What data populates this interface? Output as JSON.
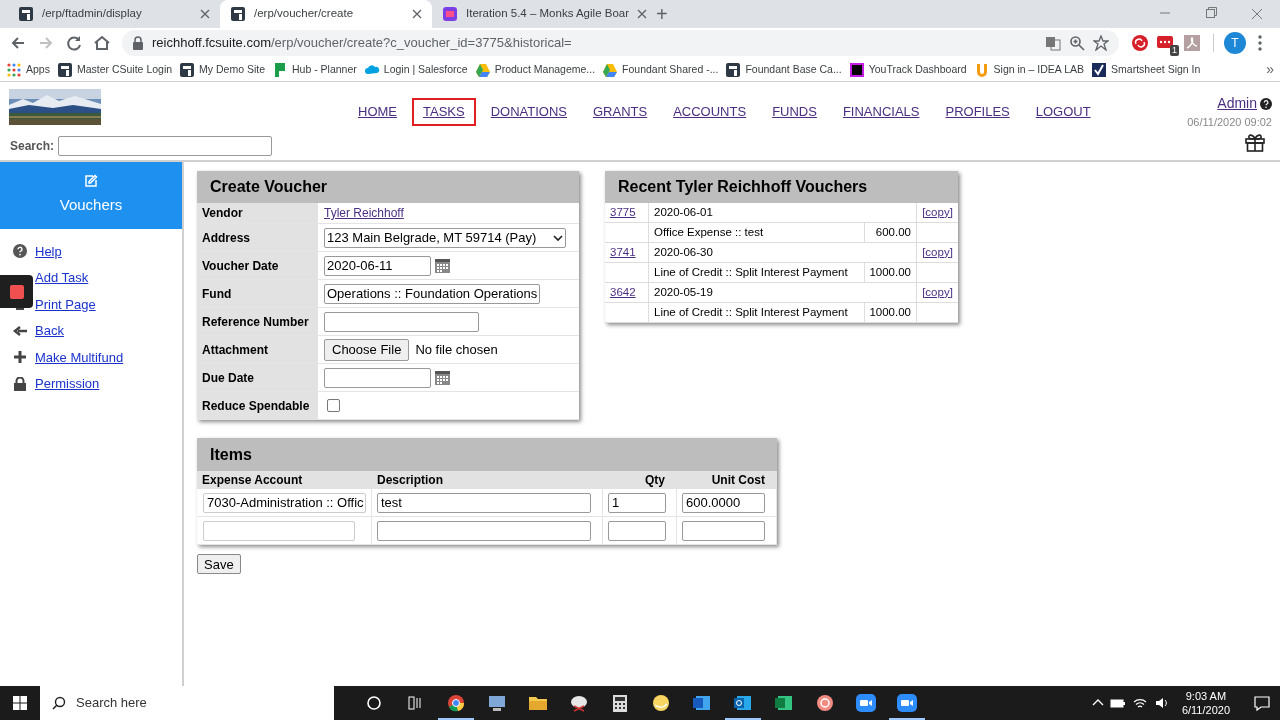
{
  "browser": {
    "tabs": [
      {
        "title": "/erp/ftadmin/display",
        "selected": false,
        "kind": "site"
      },
      {
        "title": "/erp/voucher/create",
        "selected": true,
        "kind": "site"
      },
      {
        "title": "Iteration 5.4 – Monks Agile Boar",
        "selected": false,
        "kind": "board"
      }
    ],
    "new_tab": "+",
    "url_host": "reichhoff.fcsuite.com",
    "url_path": "/erp/voucher/create?c_voucher_id=3775&historical=",
    "profile_initial": "T",
    "extension_badge": "1",
    "bookmarks": [
      {
        "label": "Apps",
        "kind": "apps"
      },
      {
        "label": "Master CSuite Login",
        "kind": "site"
      },
      {
        "label": "My Demo Site",
        "kind": "site"
      },
      {
        "label": "Hub - Planner",
        "kind": "planner"
      },
      {
        "label": "Login | Salesforce",
        "kind": "cloud"
      },
      {
        "label": "Product Manageme...",
        "kind": "drive"
      },
      {
        "label": "Foundant Shared -...",
        "kind": "drive"
      },
      {
        "label": "Foundant Base Ca...",
        "kind": "site"
      },
      {
        "label": "YouTrack Dashboard",
        "kind": "track"
      },
      {
        "label": "Sign in – IDEA LAB",
        "kind": "lab"
      },
      {
        "label": "Smartsheet Sign In",
        "kind": "sheet"
      }
    ],
    "more_bookmarks": "»"
  },
  "header": {
    "nav": [
      {
        "label": "HOME",
        "selected": false
      },
      {
        "label": "TASKS",
        "selected": true
      },
      {
        "label": "DONATIONS",
        "selected": false
      },
      {
        "label": "GRANTS",
        "selected": false
      },
      {
        "label": "ACCOUNTS",
        "selected": false
      },
      {
        "label": "FUNDS",
        "selected": false
      },
      {
        "label": "FINANCIALS",
        "selected": false
      },
      {
        "label": "PROFILES",
        "selected": false
      },
      {
        "label": "LOGOUT",
        "selected": false
      }
    ],
    "user": "Admin",
    "datetime": "06/11/2020 09:02",
    "search_label": "Search:"
  },
  "sidebar": {
    "title": "Vouchers",
    "items": [
      {
        "label": "Help",
        "kind": "help"
      },
      {
        "label": "Add Task",
        "kind": "covered"
      },
      {
        "label": "Print Page",
        "kind": "print"
      },
      {
        "label": "Back",
        "kind": "back"
      },
      {
        "label": "Make Multifund",
        "kind": "add"
      },
      {
        "label": "Permission",
        "kind": "lock"
      }
    ]
  },
  "create_voucher": {
    "title": "Create Voucher",
    "fields": [
      {
        "label": "Vendor",
        "kind": "link",
        "value": "Tyler Reichhoff"
      },
      {
        "label": "Address",
        "kind": "select",
        "value": "123 Main Belgrade, MT 59714 (Pay)"
      },
      {
        "label": "Voucher Date",
        "kind": "date",
        "value": "2020-06-11"
      },
      {
        "label": "Fund",
        "kind": "wide",
        "value": "Operations :: Foundation Operations"
      },
      {
        "label": "Reference Number",
        "kind": "text"
      },
      {
        "label": "Attachment",
        "kind": "file",
        "button": "Choose File",
        "note": "No file chosen"
      },
      {
        "label": "Due Date",
        "kind": "date"
      },
      {
        "label": "Reduce Spendable",
        "kind": "checkbox",
        "checked": false
      }
    ]
  },
  "recent": {
    "title": "Recent Tyler Reichhoff Vouchers",
    "vouchers": [
      {
        "id": "3775",
        "date": "2020-06-01",
        "copy": "[copy]",
        "line": "Office Expense :: test",
        "amount": "600.00"
      },
      {
        "id": "3741",
        "date": "2020-06-30",
        "copy": "[copy]",
        "line": "Line of Credit :: Split Interest Payment",
        "amount": "1000.00"
      },
      {
        "id": "3642",
        "date": "2020-05-19",
        "copy": "[copy]",
        "line": "Line of Credit :: Split Interest Payment",
        "amount": "1000.00"
      }
    ]
  },
  "items": {
    "title": "Items",
    "columns": [
      "Expense Account",
      "Description",
      "Qty",
      "Unit Cost"
    ],
    "rows": [
      {
        "kind": "filled",
        "account": "7030-Administration :: Offic",
        "description": "test",
        "qty": "1",
        "unit_cost": "600.0000"
      },
      {
        "kind": "blank"
      }
    ]
  },
  "save": "Save",
  "taskbar": {
    "search_placeholder": "Search here",
    "time": "9:03 AM",
    "date": "6/11/2020"
  }
}
